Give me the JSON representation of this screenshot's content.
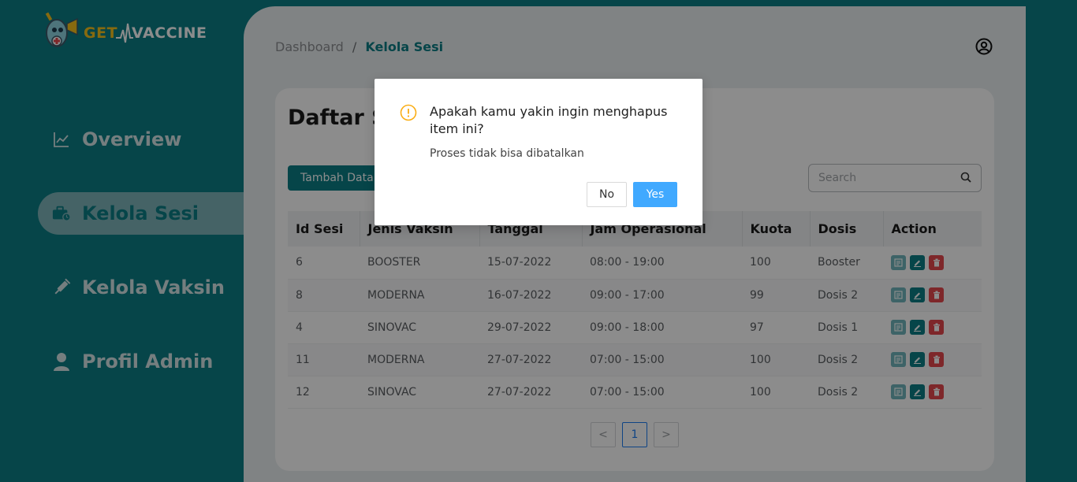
{
  "app": {
    "logo_get": "GET",
    "logo_vaccine": "VACCINE"
  },
  "sidebar": {
    "items": [
      {
        "label": "Overview",
        "icon": "chart-line-icon"
      },
      {
        "label": "Kelola Sesi",
        "icon": "briefcase-clock-icon",
        "active": true
      },
      {
        "label": "Kelola Vaksin",
        "icon": "syringe-icon"
      },
      {
        "label": "Profil Admin",
        "icon": "user-icon"
      }
    ]
  },
  "breadcrumb": {
    "root": "Dashboard",
    "separator": "/",
    "current": "Kelola Sesi"
  },
  "card": {
    "title": "Daftar Sesi",
    "add_button": "Tambah Data",
    "search_placeholder": "Search"
  },
  "table": {
    "headers": [
      "Id Sesi",
      "Jenis Vaksin",
      "Tanggal",
      "Jam Operasional",
      "Kuota",
      "Dosis",
      "Action"
    ],
    "rows": [
      {
        "id": "6",
        "jenis": "BOOSTER",
        "tanggal": "15-07-2022",
        "jam": "08:00 - 19:00",
        "kuota": "100",
        "dosis": "Booster"
      },
      {
        "id": "8",
        "jenis": "MODERNA",
        "tanggal": "16-07-2022",
        "jam": "09:00 - 17:00",
        "kuota": "99",
        "dosis": "Dosis 2"
      },
      {
        "id": "4",
        "jenis": "SINOVAC",
        "tanggal": "29-07-2022",
        "jam": "09:00 - 18:00",
        "kuota": "97",
        "dosis": "Dosis 1"
      },
      {
        "id": "11",
        "jenis": "MODERNA",
        "tanggal": "27-07-2022",
        "jam": "07:00 - 15:00",
        "kuota": "100",
        "dosis": "Dosis 2"
      },
      {
        "id": "12",
        "jenis": "SINOVAC",
        "tanggal": "27-07-2022",
        "jam": "07:00 - 15:00",
        "kuota": "100",
        "dosis": "Dosis 2"
      }
    ]
  },
  "pagination": {
    "prev": "<",
    "current_page": "1",
    "next": ">"
  },
  "modal": {
    "title": "Apakah kamu yakin ingin menghapus item ini?",
    "description": "Proses tidak bisa dibatalkan",
    "no_label": "No",
    "yes_label": "Yes",
    "icon": "warning-circle-icon"
  },
  "colors": {
    "brand": "#0b7e86",
    "accent_yellow": "#f6c21c",
    "primary_button": "#40a9ff",
    "delete": "#e5484d"
  }
}
